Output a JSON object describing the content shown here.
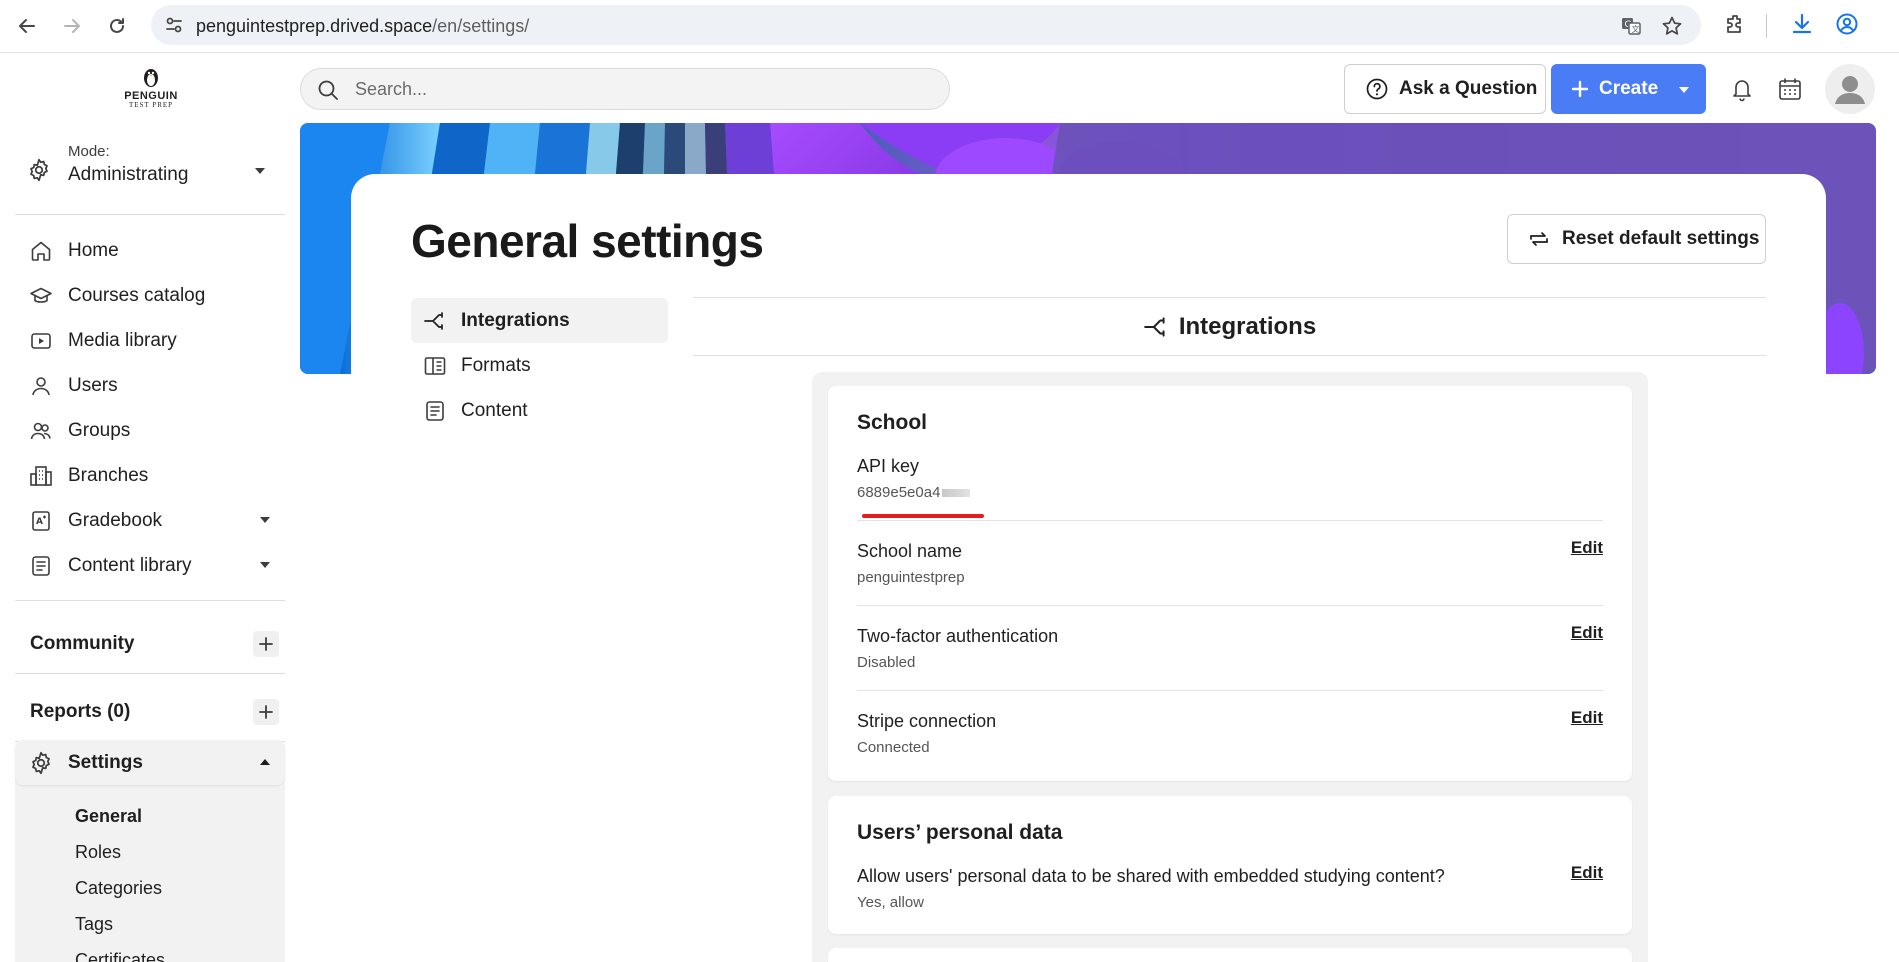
{
  "browser": {
    "url_host": "penguintestprep.drived.space",
    "url_path": "/en/settings/"
  },
  "sidebar": {
    "logo_line1": "PENGUIN",
    "logo_line2": "TEST PREP",
    "mode_label": "Mode:",
    "mode_value": "Administrating",
    "items": [
      {
        "label": "Home",
        "icon": "home-icon"
      },
      {
        "label": "Courses catalog",
        "icon": "graduation-cap-icon"
      },
      {
        "label": "Media library",
        "icon": "play-icon"
      },
      {
        "label": "Users",
        "icon": "user-icon"
      },
      {
        "label": "Groups",
        "icon": "group-icon"
      },
      {
        "label": "Branches",
        "icon": "building-icon"
      },
      {
        "label": "Gradebook",
        "icon": "gradebook-icon"
      },
      {
        "label": "Content library",
        "icon": "content-icon"
      }
    ],
    "community": "Community",
    "reports": "Reports (0)",
    "settings": "Settings",
    "settings_sub": [
      "General",
      "Roles",
      "Categories",
      "Tags",
      "Certificates"
    ]
  },
  "topbar": {
    "search_placeholder": "Search...",
    "ask_label": "Ask a Question",
    "create_label": "Create",
    "create_color": "#4a7cf6"
  },
  "main": {
    "title": "General settings",
    "reset_label": "Reset default settings",
    "tabs": [
      "Integrations",
      "Formats",
      "Content"
    ],
    "section_title": "Integrations",
    "school": {
      "title": "School",
      "api_key_label": "API key",
      "api_key_value": "6889e5e0a4",
      "edit_label": "Edit",
      "rows": [
        {
          "label": "School name",
          "value": "penguintestprep"
        },
        {
          "label": "Two-factor authentication",
          "value": "Disabled"
        },
        {
          "label": "Stripe connection",
          "value": "Connected"
        }
      ]
    },
    "personal": {
      "title": "Users’ personal data",
      "row_label": "Allow users' personal data to be shared with embedded studying content?",
      "row_value": "Yes, allow",
      "edit_label": "Edit"
    }
  }
}
